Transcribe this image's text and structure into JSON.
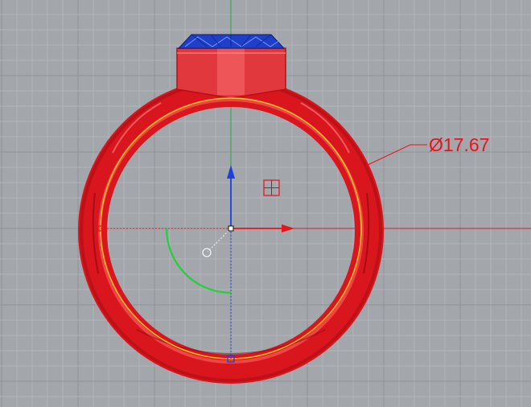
{
  "viewport": {
    "view_name": "Front",
    "background_color": "#a3a6ab",
    "grid_minor_color": "#b2b5b9",
    "grid_major_color": "#8f9296"
  },
  "model": {
    "selection_color": "#e8141b",
    "ring_inner_edge_color": "#f3c221",
    "gem_color": "#2046c8"
  },
  "dimension": {
    "label": "Ø17.67",
    "color": "#e8141b"
  },
  "gumball": {
    "x_axis_color": "#e8141b",
    "y_axis_color": "#1f3fe0",
    "rotate_handle_color": "#22d13a"
  },
  "icons": {
    "gumball_scale_handle": "grid-square-icon",
    "gumball_origin": "origin-square-icon",
    "gumball_rotate_pivot": "circle-handle-icon",
    "quadrant_left": "quadrant-point-icon",
    "quadrant_bottom": "quadrant-point-icon"
  }
}
